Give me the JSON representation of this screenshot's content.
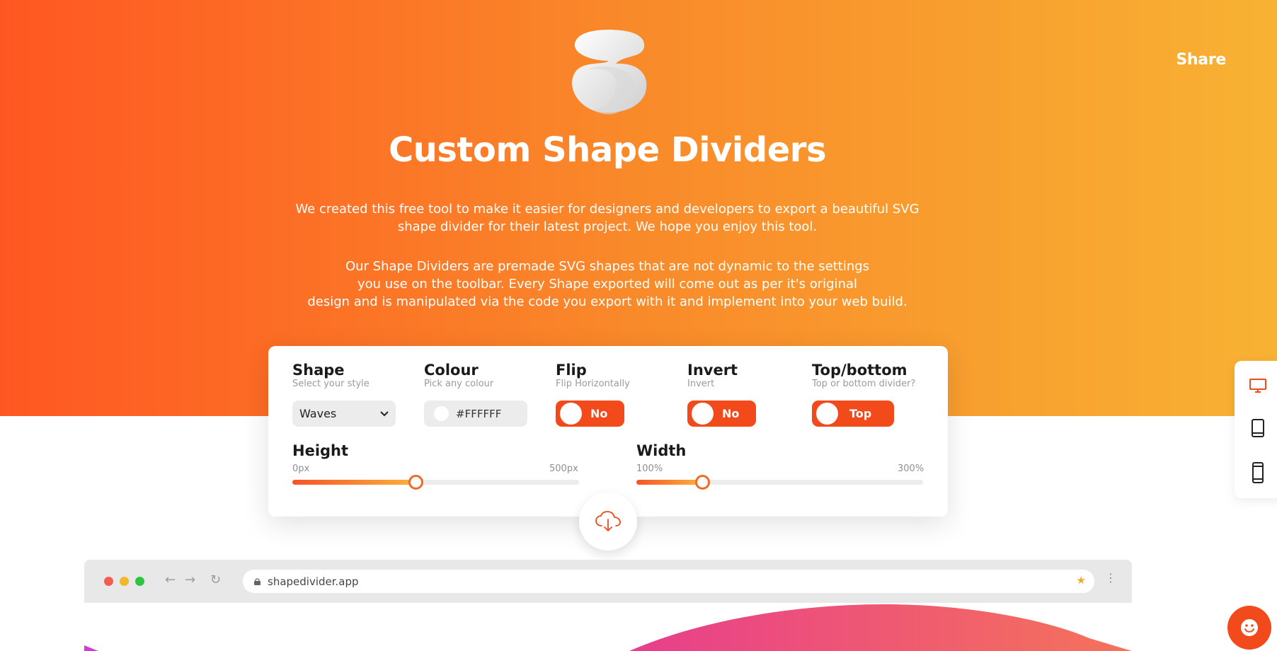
{
  "header": {
    "share_label": "Share",
    "title": "Custom Shape Dividers",
    "description_1": "We created this free tool to make it easier for designers and developers to export a beautiful SVG\nshape divider for their latest project. We hope you enjoy this tool.",
    "description_2": "Our Shape Dividers are premade SVG shapes that are not dynamic to the settings\nyou use on the toolbar. Every Shape exported will come out as per it's original\ndesign and is manipulated via the code you export with it and implement into your web build."
  },
  "toolbar": {
    "shape": {
      "label": "Shape",
      "sub": "Select your style",
      "value": "Waves"
    },
    "colour": {
      "label": "Colour",
      "sub": "Pick any colour",
      "value": "#FFFFFF"
    },
    "flip": {
      "label": "Flip",
      "sub": "Flip Horizontally",
      "value": "No"
    },
    "invert": {
      "label": "Invert",
      "sub": "Invert",
      "value": "No"
    },
    "topbottom": {
      "label": "Top/bottom",
      "sub": "Top or bottom divider?",
      "value": "Top"
    },
    "height": {
      "label": "Height",
      "min": "0px",
      "max": "500px",
      "fraction": 0.43
    },
    "width": {
      "label": "Width",
      "min": "100%",
      "max": "300%",
      "fraction": 0.23
    }
  },
  "devices": [
    "desktop-icon",
    "tablet-icon",
    "mobile-icon"
  ],
  "browser": {
    "url": "shapedivider.app"
  },
  "colors": {
    "accent": "#f24a1a",
    "gradient_start": "#ff5722",
    "gradient_end": "#f8b233"
  }
}
